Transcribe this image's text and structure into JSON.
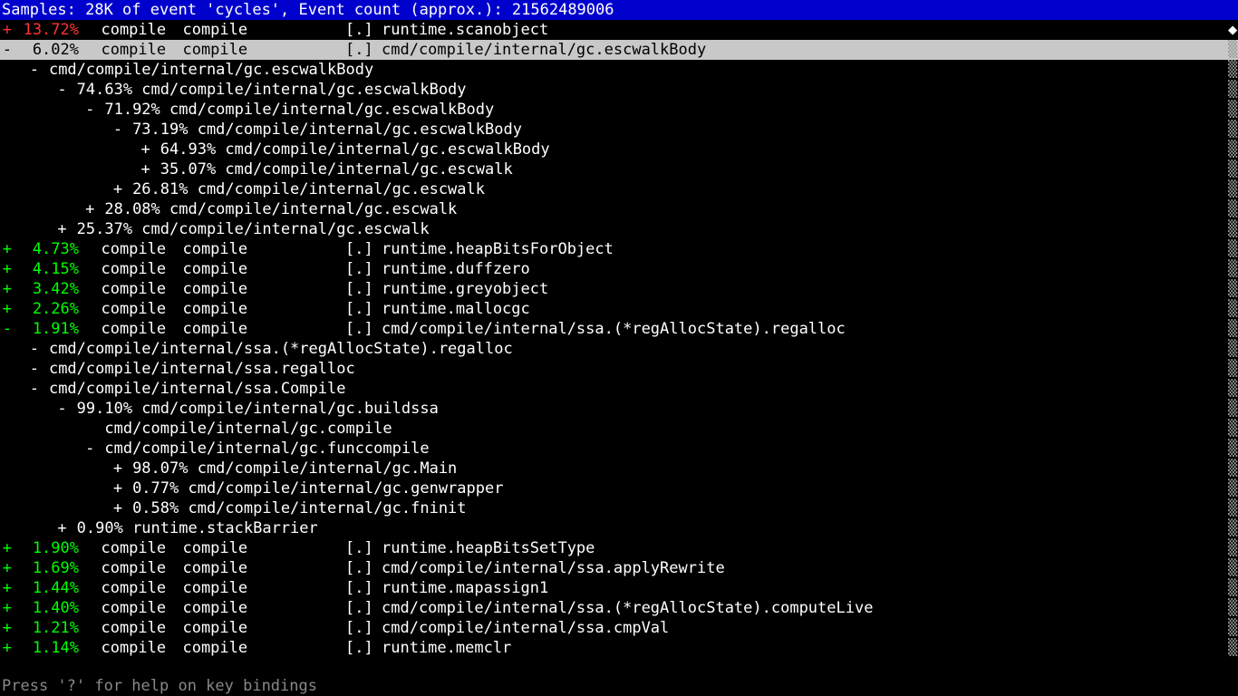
{
  "header": "Samples: 28K of event 'cycles', Event count (approx.): 21562489006",
  "footer": "Press '?' for help on key bindings",
  "cols": {
    "command": "compile",
    "dso": "compile",
    "bracket": "[.]"
  },
  "rows": [
    {
      "type": "top",
      "sign": "+",
      "signColor": "red",
      "pct": "13.72%",
      "pctColor": "red",
      "func": "runtime.scanobject",
      "marker": "diamond"
    },
    {
      "type": "top",
      "sign": "-",
      "signColor": "selblack",
      "pct": "6.02%",
      "pctColor": "selblack",
      "func": "cmd/compile/internal/gc.escwalkBody",
      "selected": true
    },
    {
      "type": "tree",
      "indent": 3,
      "sign": "-",
      "text": "cmd/compile/internal/gc.escwalkBody"
    },
    {
      "type": "tree",
      "indent": 6,
      "sign": "-",
      "text": "74.63% cmd/compile/internal/gc.escwalkBody"
    },
    {
      "type": "tree",
      "indent": 9,
      "sign": "-",
      "text": "71.92% cmd/compile/internal/gc.escwalkBody"
    },
    {
      "type": "tree",
      "indent": 12,
      "sign": "-",
      "text": "73.19% cmd/compile/internal/gc.escwalkBody"
    },
    {
      "type": "tree",
      "indent": 15,
      "sign": "+",
      "text": "64.93% cmd/compile/internal/gc.escwalkBody"
    },
    {
      "type": "tree",
      "indent": 15,
      "sign": "+",
      "text": "35.07% cmd/compile/internal/gc.escwalk"
    },
    {
      "type": "tree",
      "indent": 12,
      "sign": "+",
      "text": "26.81% cmd/compile/internal/gc.escwalk"
    },
    {
      "type": "tree",
      "indent": 9,
      "sign": "+",
      "text": "28.08% cmd/compile/internal/gc.escwalk"
    },
    {
      "type": "tree",
      "indent": 6,
      "sign": "+",
      "text": "25.37% cmd/compile/internal/gc.escwalk"
    },
    {
      "type": "top",
      "sign": "+",
      "signColor": "green",
      "pct": "4.73%",
      "pctColor": "green",
      "func": "runtime.heapBitsForObject"
    },
    {
      "type": "top",
      "sign": "+",
      "signColor": "green",
      "pct": "4.15%",
      "pctColor": "green",
      "func": "runtime.duffzero"
    },
    {
      "type": "top",
      "sign": "+",
      "signColor": "green",
      "pct": "3.42%",
      "pctColor": "green",
      "func": "runtime.greyobject"
    },
    {
      "type": "top",
      "sign": "+",
      "signColor": "green",
      "pct": "2.26%",
      "pctColor": "green",
      "func": "runtime.mallocgc"
    },
    {
      "type": "top",
      "sign": "-",
      "signColor": "green",
      "pct": "1.91%",
      "pctColor": "green",
      "func": "cmd/compile/internal/ssa.(*regAllocState).regalloc"
    },
    {
      "type": "tree",
      "indent": 3,
      "sign": "-",
      "text": "cmd/compile/internal/ssa.(*regAllocState).regalloc"
    },
    {
      "type": "tree",
      "indent": 3,
      "sign": "-",
      "text": "cmd/compile/internal/ssa.regalloc"
    },
    {
      "type": "tree",
      "indent": 3,
      "sign": "-",
      "text": "cmd/compile/internal/ssa.Compile"
    },
    {
      "type": "tree",
      "indent": 6,
      "sign": "-",
      "text": "99.10% cmd/compile/internal/gc.buildssa"
    },
    {
      "type": "tree",
      "indent": 9,
      "sign": " ",
      "text": "cmd/compile/internal/gc.compile"
    },
    {
      "type": "tree",
      "indent": 9,
      "sign": "-",
      "text": "cmd/compile/internal/gc.funccompile"
    },
    {
      "type": "tree",
      "indent": 12,
      "sign": "+",
      "text": "98.07% cmd/compile/internal/gc.Main"
    },
    {
      "type": "tree",
      "indent": 12,
      "sign": "+",
      "text": "0.77% cmd/compile/internal/gc.genwrapper"
    },
    {
      "type": "tree",
      "indent": 12,
      "sign": "+",
      "text": "0.58% cmd/compile/internal/gc.fninit"
    },
    {
      "type": "tree",
      "indent": 6,
      "sign": "+",
      "text": "0.90% runtime.stackBarrier"
    },
    {
      "type": "top",
      "sign": "+",
      "signColor": "green",
      "pct": "1.90%",
      "pctColor": "green",
      "func": "runtime.heapBitsSetType"
    },
    {
      "type": "top",
      "sign": "+",
      "signColor": "green",
      "pct": "1.69%",
      "pctColor": "green",
      "func": "cmd/compile/internal/ssa.applyRewrite"
    },
    {
      "type": "top",
      "sign": "+",
      "signColor": "green",
      "pct": "1.44%",
      "pctColor": "green",
      "func": "runtime.mapassign1"
    },
    {
      "type": "top",
      "sign": "+",
      "signColor": "green",
      "pct": "1.40%",
      "pctColor": "green",
      "func": "cmd/compile/internal/ssa.(*regAllocState).computeLive"
    },
    {
      "type": "top",
      "sign": "+",
      "signColor": "green",
      "pct": "1.21%",
      "pctColor": "green",
      "func": "cmd/compile/internal/ssa.cmpVal"
    },
    {
      "type": "top",
      "sign": "+",
      "signColor": "green",
      "pct": "1.14%",
      "pctColor": "green",
      "func": "runtime.memclr"
    }
  ],
  "scrollbarGlyph": "▒",
  "scrollbarTopGlyph": "◆"
}
